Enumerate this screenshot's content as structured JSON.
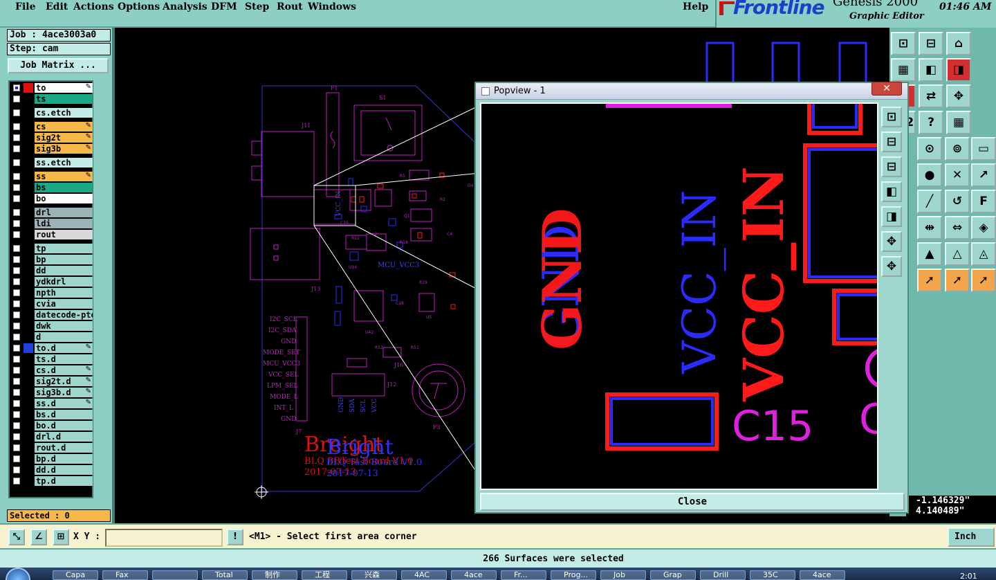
{
  "menu": {
    "items": [
      "File",
      "Edit",
      "Actions",
      "Options",
      "Analysis",
      "DFM",
      "Step",
      "Rout",
      "Windows"
    ],
    "help": "Help"
  },
  "brand": {
    "logo": "Frontline",
    "title": "Genesis 2000",
    "subtitle": "Graphic Editor",
    "time": "01:46 AM"
  },
  "job": {
    "job_label": "Job : 4ace3003a0",
    "step_label": "Step: cam",
    "matrix_button": "Job Matrix ..."
  },
  "layers": [
    {
      "name": "to",
      "color": "#ffffff",
      "swatch": "#e01010",
      "selected": true,
      "affected": true
    },
    {
      "name": "ts",
      "color": "#1aa886",
      "swatch": "",
      "selected": false,
      "affected": false
    },
    {
      "name": "cs.etch",
      "color": "#c4ece6",
      "swatch": "",
      "selected": false,
      "affected": false,
      "gap": true
    },
    {
      "name": "cs",
      "color": "#f6b949",
      "swatch": "",
      "selected": false,
      "affected": true,
      "gap": true
    },
    {
      "name": "sig2t",
      "color": "#f6b949",
      "swatch": "",
      "selected": false,
      "affected": true
    },
    {
      "name": "sig3b",
      "color": "#f6b949",
      "swatch": "",
      "selected": false,
      "affected": true
    },
    {
      "name": "ss.etch",
      "color": "#c4ece6",
      "swatch": "",
      "selected": false,
      "affected": false,
      "gap": true
    },
    {
      "name": "ss",
      "color": "#f6b949",
      "swatch": "",
      "selected": false,
      "affected": true,
      "gap": true
    },
    {
      "name": "bs",
      "color": "#1aa886",
      "swatch": "",
      "selected": false,
      "affected": false
    },
    {
      "name": "bo",
      "color": "#ffffff",
      "swatch": "",
      "selected": false,
      "affected": false
    },
    {
      "name": "drl",
      "color": "#9ab3b6",
      "swatch": "",
      "selected": false,
      "affected": false,
      "gap": true
    },
    {
      "name": "ldi",
      "color": "#9ab3b6",
      "swatch": "",
      "selected": false,
      "affected": false
    },
    {
      "name": "rout",
      "color": "#d8d8d8",
      "swatch": "",
      "selected": false,
      "affected": false
    },
    {
      "name": "tp",
      "color": "#9ed5cc",
      "swatch": "",
      "selected": false,
      "affected": false,
      "gap": true
    },
    {
      "name": "bp",
      "color": "#9ed5cc",
      "swatch": "",
      "selected": false,
      "affected": false
    },
    {
      "name": "dd",
      "color": "#9ed5cc",
      "swatch": "",
      "selected": false,
      "affected": false
    },
    {
      "name": "ydkdrl",
      "color": "#9ed5cc",
      "swatch": "",
      "selected": false,
      "affected": false
    },
    {
      "name": "npth",
      "color": "#9ed5cc",
      "swatch": "",
      "selected": false,
      "affected": false
    },
    {
      "name": "cvia",
      "color": "#9ed5cc",
      "swatch": "",
      "selected": false,
      "affected": false
    },
    {
      "name": "datecode-pte",
      "color": "#9ed5cc",
      "swatch": "",
      "selected": false,
      "affected": false
    },
    {
      "name": "dwk",
      "color": "#9ed5cc",
      "swatch": "",
      "selected": false,
      "affected": false
    },
    {
      "name": "d",
      "color": "#9ed5cc",
      "swatch": "",
      "selected": false,
      "affected": false
    },
    {
      "name": "to.d",
      "color": "#9ed5cc",
      "swatch": "#2040e0",
      "selected": false,
      "affected": true
    },
    {
      "name": "ts.d",
      "color": "#9ed5cc",
      "swatch": "",
      "selected": false,
      "affected": false
    },
    {
      "name": "cs.d",
      "color": "#9ed5cc",
      "swatch": "",
      "selected": false,
      "affected": true
    },
    {
      "name": "sig2t.d",
      "color": "#9ed5cc",
      "swatch": "",
      "selected": false,
      "affected": true
    },
    {
      "name": "sig3b.d",
      "color": "#9ed5cc",
      "swatch": "",
      "selected": false,
      "affected": true
    },
    {
      "name": "ss.d",
      "color": "#9ed5cc",
      "swatch": "",
      "selected": false,
      "affected": true
    },
    {
      "name": "bs.d",
      "color": "#9ed5cc",
      "swatch": "",
      "selected": false,
      "affected": false
    },
    {
      "name": "bo.d",
      "color": "#9ed5cc",
      "swatch": "",
      "selected": false,
      "affected": false
    },
    {
      "name": "drl.d",
      "color": "#9ed5cc",
      "swatch": "",
      "selected": false,
      "affected": false
    },
    {
      "name": "rout.d",
      "color": "#9ed5cc",
      "swatch": "",
      "selected": false,
      "affected": false
    },
    {
      "name": "bp.d",
      "color": "#9ed5cc",
      "swatch": "",
      "selected": false,
      "affected": false
    },
    {
      "name": "dd.d",
      "color": "#9ed5cc",
      "swatch": "",
      "selected": false,
      "affected": false
    },
    {
      "name": "tp.d",
      "color": "#9ed5cc",
      "swatch": "",
      "selected": false,
      "affected": false
    }
  ],
  "selected_label": "Selected : 0",
  "board": {
    "designators": [
      "F1",
      "S1",
      "J11",
      "J13",
      "J12",
      "J16",
      "J7",
      "F3",
      "L2",
      "U14",
      "U5",
      "U42",
      "C15",
      "C18",
      "Q1",
      "R2",
      "R5",
      "R12",
      "R18",
      "R19",
      "R51",
      "R52",
      "C4",
      "D4"
    ],
    "net_labels": [
      "MCU_VCC3",
      "GND",
      "SDA",
      "SCL",
      "VCC",
      "VCC_IN"
    ],
    "silkscreen_lines": [
      "Breight",
      "BLQ BBTest Board V1.0",
      "2017-07-13"
    ],
    "silkscreen_overlay": [
      "Bright",
      "BLQ Test Board V1.0",
      "2017-07-13"
    ]
  },
  "popview": {
    "title": "Popview - 1",
    "labels": {
      "gnd_blue": "GND",
      "gnd_red": "GND",
      "vcc_blue": "VCC_IN",
      "vcc_red": "VCC_IN",
      "c15": "C15",
      "c_partial": "C"
    },
    "close_label": "Close"
  },
  "toolbar_icons": [
    "snap-icon",
    "save-icon",
    "home-icon",
    "layout-icon",
    "move-left-icon",
    "move-right-icon",
    "flip-icon",
    "swap-icon",
    "zoom-fit-icon",
    "scale-icon",
    "help-icon",
    "grid-icon",
    "net-icon",
    "net2-icon",
    "ruler-icon",
    "dot-icon",
    "cross-icon",
    "arc-icon",
    "line-icon",
    "rotate-icon",
    "text-icon",
    "width-icon",
    "measure-icon",
    "pad-icon",
    "tri-icon",
    "tri2-icon",
    "tri3-icon",
    "pointer-icon",
    "pointer2-icon",
    "pointer3-icon"
  ],
  "coordinates": {
    "x": "-1.146329\"",
    "y": "4.140489\""
  },
  "command": {
    "xy_label": "X Y :",
    "xy_value": "",
    "message": "<M1> - Select first area corner",
    "units": "Inch"
  },
  "status": "266 Surfaces were selected",
  "taskbar": {
    "items": [
      "Capa",
      "Fax",
      "",
      "Total",
      "制作",
      "工程",
      "兴森",
      "4AC",
      "4ace",
      "Fr...",
      "Prog...",
      "Job",
      "Grap",
      "Drill",
      "35C",
      "4ace"
    ],
    "time": "2:01"
  },
  "colors": {
    "panel": "#8ecfc5",
    "active_layer": "#f6b949",
    "red_layer": "#ff1a1a",
    "blue_layer": "#2222ff",
    "silk": "#c020c0",
    "outline": "#3838d0"
  }
}
